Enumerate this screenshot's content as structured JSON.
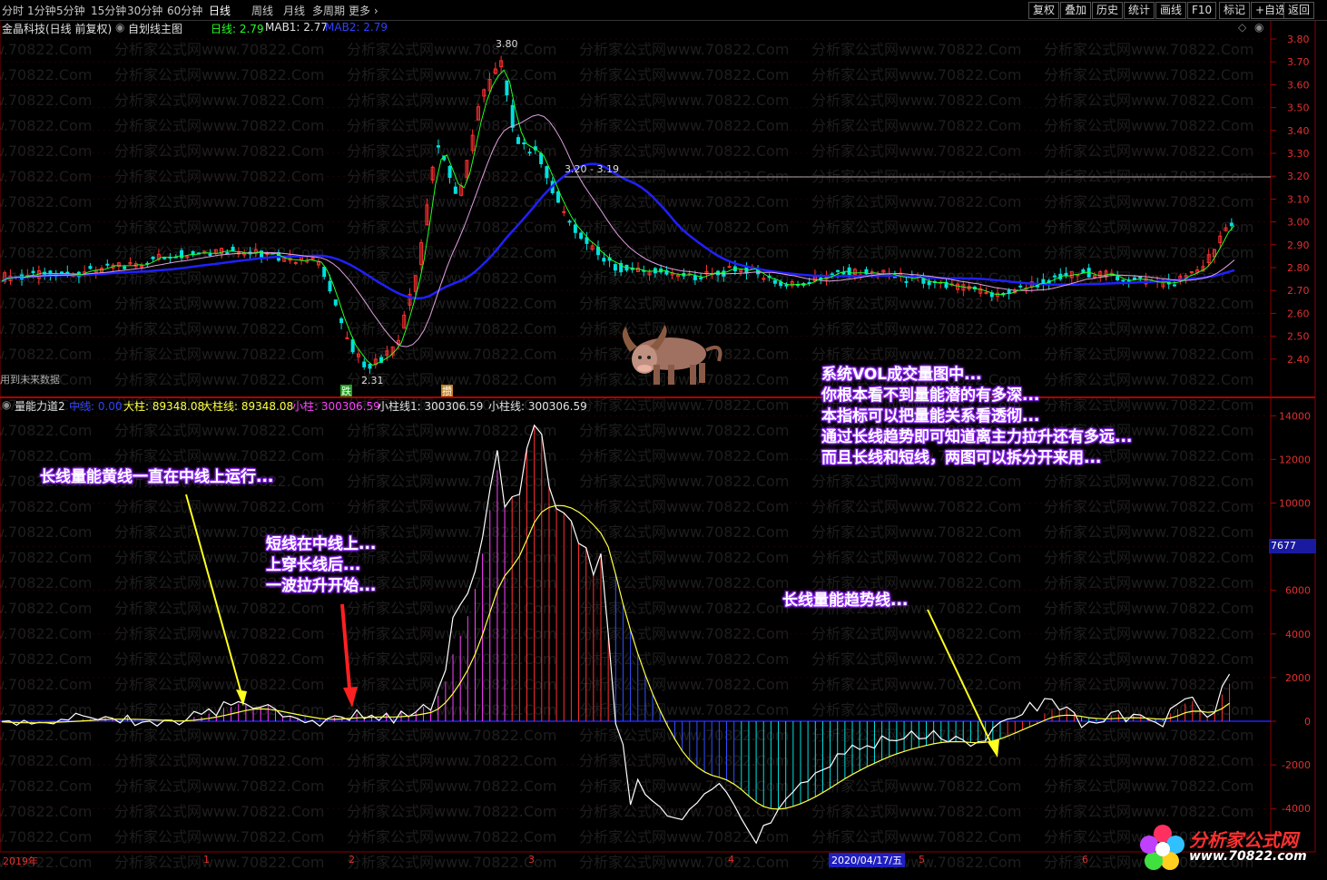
{
  "toolbar": {
    "tabs": [
      "分时",
      "1分钟",
      "5分钟",
      "15分钟",
      "30分钟",
      "60分钟",
      "日线",
      "周线",
      "月线",
      "多周期",
      "更多"
    ],
    "active_tab": "日线",
    "buttons": [
      "复权",
      "叠加",
      "历史",
      "统计",
      "画线",
      "F10",
      "标记",
      "+自选",
      "返回"
    ]
  },
  "info": {
    "stock": "金晶科技(日线 前复权)",
    "indicator_name": "自划线主图",
    "daily_line": "日线: 2.79",
    "mab1": "MAB1: 2.77",
    "mab2": "MAB2: 2.79"
  },
  "price_axis": [
    "3.80",
    "3.70",
    "3.60",
    "3.50",
    "3.40",
    "3.30",
    "3.20",
    "3.10",
    "3.00",
    "2.90",
    "2.80",
    "2.70",
    "2.60",
    "2.50",
    "2.40"
  ],
  "price_marks": {
    "high": "3.80",
    "low": "2.31",
    "mid": "3.20 - 3.19",
    "future": "用到未来数据",
    "flag_down": "跌",
    "flag_up": "攒"
  },
  "indicator": {
    "name": "量能力道2",
    "mid": "中线: 0.00",
    "big_col": "大柱: 89348.08",
    "big_col_line": "大柱线: 89348.08",
    "small_col": "小柱: 300306.59",
    "small_col_line1": "小柱线1: 300306.59",
    "small_col_line": "小柱线: 300306.59",
    "current_value": "7677"
  },
  "vol_axis": [
    "14000",
    "12000",
    "10000",
    "8000",
    "6000",
    "4000",
    "2000",
    "0",
    "-2000",
    "-4000"
  ],
  "callouts": {
    "left": "长线量能黄线一直在中线上运行...",
    "short": [
      "短线在中线上...",
      "上穿长线后...",
      "一波拉升开始..."
    ],
    "right": [
      "系统VOL成交量图中...",
      "你根本看不到量能潜的有多深...",
      "本指标可以把量能关系看透彻...",
      "通过长线趋势即可知道离主力拉升还有多远...",
      "而且长线和短线，两图可以拆分开来用..."
    ],
    "trend": "长线量能趋势线..."
  },
  "footer": {
    "year": "2019年",
    "months": [
      "1",
      "2",
      "3",
      "4",
      "5",
      "6"
    ],
    "date": "2020/04/17/五"
  },
  "logo": {
    "name": "分析家公式网",
    "url": "www.70822.com"
  },
  "watermark": "分析家公式网www.70822.Com",
  "colors": {
    "up": "#ff3030",
    "down": "#00e0e0",
    "ma_long": "#2020ff",
    "ma_mid": "#e0a0e0",
    "green_line": "#20ff20",
    "yellow": "#ffff40",
    "accent": "#9a30ff"
  }
}
